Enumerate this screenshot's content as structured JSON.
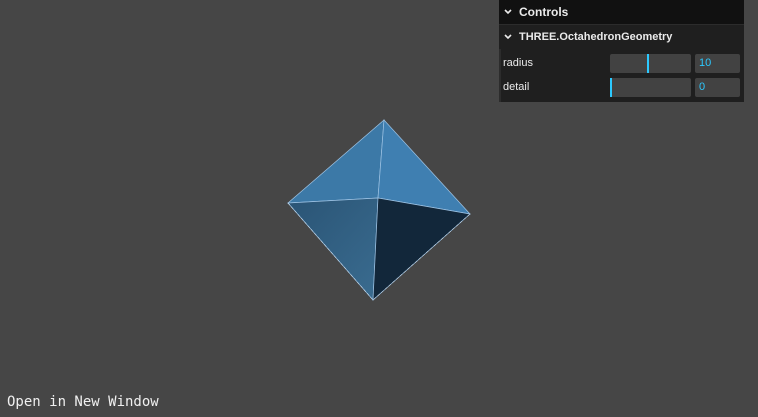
{
  "link": {
    "open_window": "Open in New Window"
  },
  "gui": {
    "title": "Controls",
    "folder": {
      "title": "THREE.OctahedronGeometry",
      "controls": [
        {
          "label": "radius",
          "value": "10",
          "fraction": 0.47
        },
        {
          "label": "detail",
          "value": "0",
          "fraction": 0.0
        }
      ]
    },
    "colors": {
      "panel_bg": "#1f1f1f",
      "title_bg": "#111111",
      "accent": "#2cc9ff",
      "widget_bg": "#424242"
    }
  },
  "scene": {
    "background": "#464646",
    "object": "octahedron",
    "face_colors": [
      "#3d7aa8",
      "#3f7fb0",
      "#2e5a7d",
      "#13283a"
    ],
    "edge_color": "#a9c9e6"
  }
}
